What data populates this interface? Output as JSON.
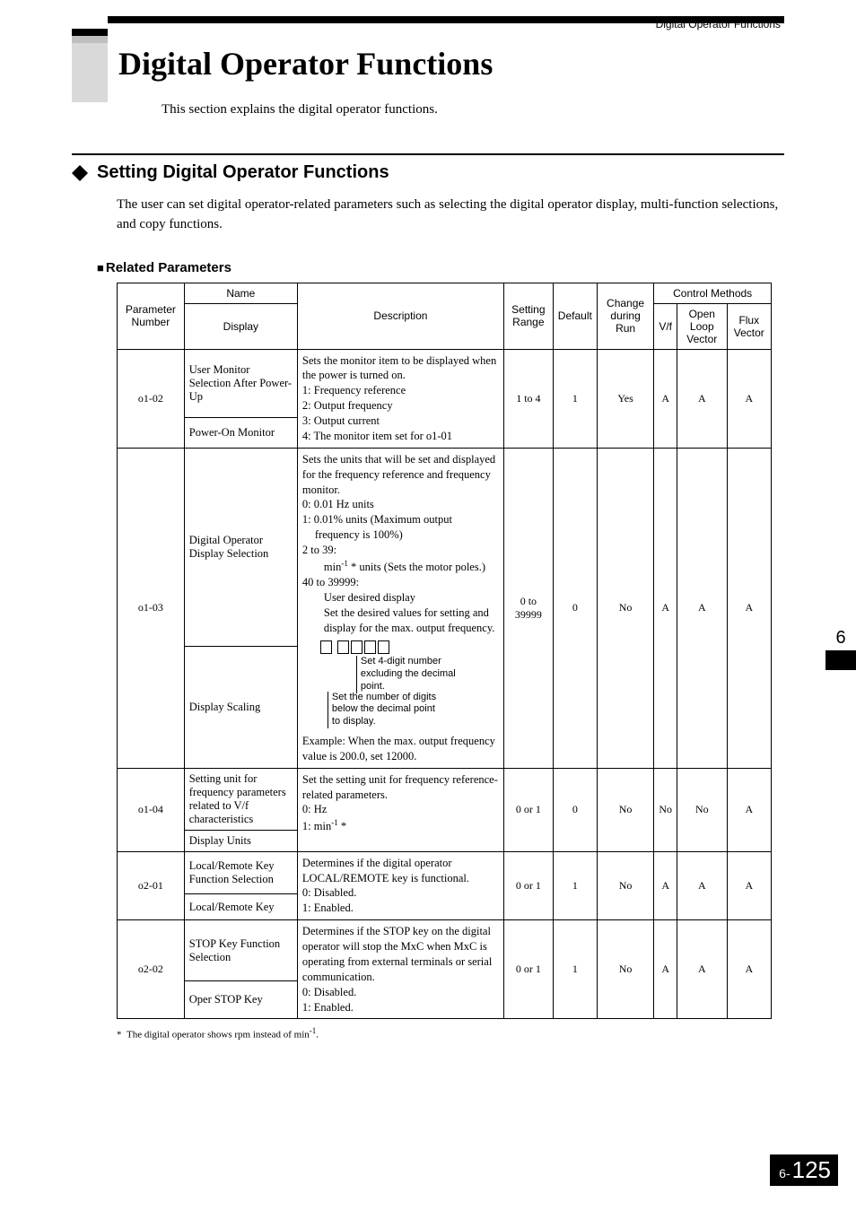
{
  "running_head": "Digital Operator Functions",
  "title": "Digital Operator Functions",
  "intro": "This section explains the digital operator functions.",
  "h2": "Setting Digital Operator Functions",
  "body": "The user can set digital operator-related parameters such as selecting the digital operator display, multi-function selections, and copy functions.",
  "h3": "Related Parameters",
  "side_tab": "6",
  "page_chapter": "6-",
  "page_number": "125",
  "footnote": "*  The digital operator shows rpm instead of min⁻¹.",
  "table": {
    "headers": {
      "param_no": "Parameter Number",
      "name": "Name",
      "display": "Display",
      "description": "Description",
      "range": "Setting Range",
      "default": "Default",
      "change": "Change during Run",
      "control": "Control Methods",
      "vf": "V/f",
      "olv": "Open Loop Vector",
      "fv": "Flux Vector"
    },
    "rows": [
      {
        "no": "o1-02",
        "name": "User Monitor Selection After Power-Up",
        "display": "Power-On Monitor",
        "desc_lead": "Sets the monitor item to be displayed when the power is turned on.",
        "opts": [
          "1:  Frequency reference",
          "2:  Output frequency",
          "3:  Output current",
          "4:  The monitor item set for o1-01"
        ],
        "range": "1 to 4",
        "default": "1",
        "change": "Yes",
        "vf": "A",
        "olv": "A",
        "fv": "A"
      },
      {
        "no": "o1-03",
        "name": "Digital Operator Display Selection",
        "display": "Display Scaling",
        "desc_lead": "Sets the units that will be set and displayed for the frequency reference and frequency monitor.",
        "opts": [
          "0:  0.01 Hz units",
          "1:  0.01% units (Maximum output frequency is 100%)",
          "2 to 39:",
          "    min⁻¹ * units (Sets the motor poles.)",
          "40 to 39999:",
          "    User desired display",
          "    Set the desired values for setting and display for the max. output frequency."
        ],
        "diagram_a": "Set 4-digit number excluding the decimal point.",
        "diagram_b": "Set the number of digits below the decimal point to display.",
        "desc_tail": "Example: When the max. output frequency value is 200.0, set 12000.",
        "range": "0 to 39999",
        "default": "0",
        "change": "No",
        "vf": "A",
        "olv": "A",
        "fv": "A"
      },
      {
        "no": "o1-04",
        "name": "Setting unit for frequency parameters related to V/f characteristics",
        "display": "Display Units",
        "desc_lead": "Set the setting unit for frequency reference-related parameters.",
        "opts": [
          "0:  Hz",
          "1:  min⁻¹ *"
        ],
        "range": "0 or 1",
        "default": "0",
        "change": "No",
        "vf": "No",
        "olv": "No",
        "fv": "A"
      },
      {
        "no": "o2-01",
        "name": "Local/Remote Key Function Selection",
        "display": "Local/Remote Key",
        "desc_lead": "Determines if the digital operator LOCAL/REMOTE key is functional.",
        "opts": [
          "0:  Disabled.",
          "1:  Enabled."
        ],
        "range": "0 or 1",
        "default": "1",
        "change": "No",
        "vf": "A",
        "olv": "A",
        "fv": "A"
      },
      {
        "no": "o2-02",
        "name": "STOP Key Function Selection",
        "display": "Oper STOP Key",
        "desc_lead": "Determines if the STOP key on the digital operator will stop the MxC when MxC is operating from external terminals or serial communication.",
        "opts": [
          "0:  Disabled.",
          "1:  Enabled."
        ],
        "range": "0 or 1",
        "default": "1",
        "change": "No",
        "vf": "A",
        "olv": "A",
        "fv": "A"
      }
    ]
  }
}
